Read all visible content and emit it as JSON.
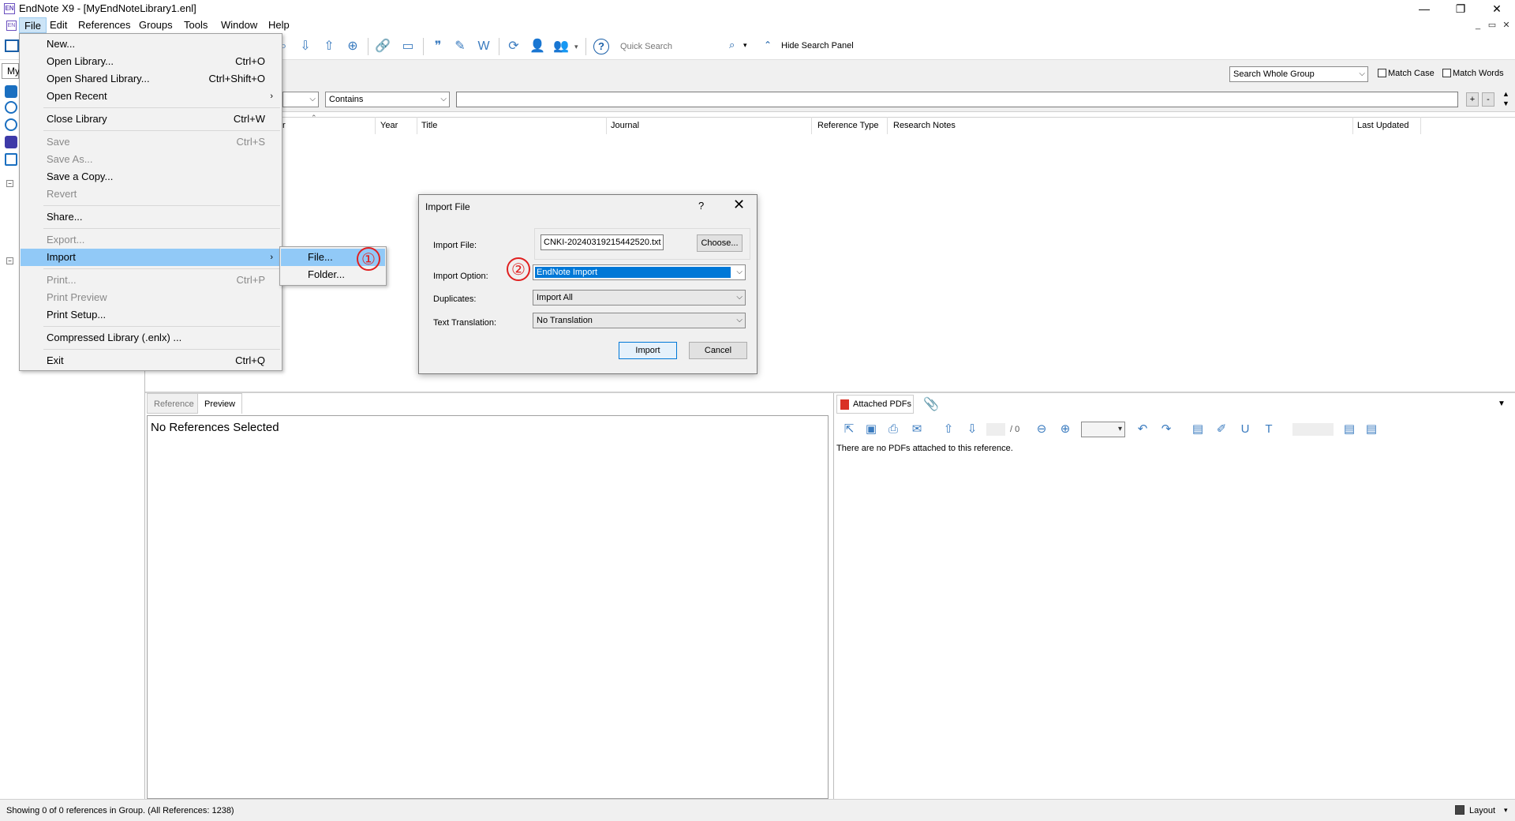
{
  "window": {
    "title": "EndNote X9 - [MyEndNoteLibrary1.enl]",
    "app_icon": "EN",
    "minimize": "—",
    "restore": "❐",
    "close": "✕"
  },
  "menubar": {
    "file": "File",
    "edit": "Edit",
    "references": "References",
    "groups": "Groups",
    "tools": "Tools",
    "window": "Window",
    "help": "Help"
  },
  "toolbar": {
    "quick_search_placeholder": "Quick Search",
    "hide_search_panel": "Hide Search Panel"
  },
  "search_panel": {
    "scope": "Search Whole Group",
    "match_case": "Match Case",
    "match_words": "Match Words",
    "condition": "Contains",
    "add": "+",
    "remove": "-"
  },
  "left_panel": {
    "tab_label": "My"
  },
  "columns": [
    "r",
    "Year",
    "Title",
    "Journal",
    "Reference Type",
    "Research Notes",
    "Last Updated"
  ],
  "file_menu": {
    "items": [
      {
        "label": "New...",
        "shortcut": "",
        "disabled": false
      },
      {
        "label": "Open Library...",
        "shortcut": "Ctrl+O",
        "disabled": false
      },
      {
        "label": "Open Shared Library...",
        "shortcut": "Ctrl+Shift+O",
        "disabled": false
      },
      {
        "label": "Open Recent",
        "shortcut": "",
        "disabled": false
      },
      {
        "label": "Close Library",
        "shortcut": "Ctrl+W",
        "disabled": false
      },
      {
        "label": "Save",
        "shortcut": "Ctrl+S",
        "disabled": true
      },
      {
        "label": "Save As...",
        "shortcut": "",
        "disabled": true
      },
      {
        "label": "Save a Copy...",
        "shortcut": "",
        "disabled": false
      },
      {
        "label": "Revert",
        "shortcut": "",
        "disabled": true
      },
      {
        "label": "Share...",
        "shortcut": "",
        "disabled": false
      },
      {
        "label": "Export...",
        "shortcut": "",
        "disabled": true
      },
      {
        "label": "Import",
        "shortcut": "",
        "disabled": false
      },
      {
        "label": "Print...",
        "shortcut": "Ctrl+P",
        "disabled": true
      },
      {
        "label": "Print Preview",
        "shortcut": "",
        "disabled": true
      },
      {
        "label": "Print Setup...",
        "shortcut": "",
        "disabled": false
      },
      {
        "label": "Compressed Library (.enlx) ...",
        "shortcut": "",
        "disabled": false
      },
      {
        "label": "Exit",
        "shortcut": "Ctrl+Q",
        "disabled": false
      }
    ],
    "submenu_arrow": "›"
  },
  "import_submenu": {
    "file": "File...",
    "folder": "Folder..."
  },
  "annotations": {
    "step1": "①",
    "step2": "②"
  },
  "import_dialog": {
    "title": "Import File",
    "help": "?",
    "close": "✕",
    "import_file_label": "Import File:",
    "import_file_value": "CNKI-20240319215442520.txt",
    "choose": "Choose...",
    "import_option_label": "Import Option:",
    "import_option_value": "EndNote Import",
    "duplicates_label": "Duplicates:",
    "duplicates_value": "Import All",
    "text_translation_label": "Text Translation:",
    "text_translation_value": "No Translation",
    "import_button": "Import",
    "cancel_button": "Cancel"
  },
  "bottom_tabs": {
    "reference": "Reference",
    "preview": "Preview"
  },
  "preview": {
    "message": "No References Selected"
  },
  "pdf_panel": {
    "tab": "Attached PDFs",
    "message": "There are no PDFs attached to this reference.",
    "page_count": "/ 0"
  },
  "status": {
    "text": "Showing 0 of 0 references in Group. (All References: 1238)",
    "layout": "Layout"
  },
  "colors": {
    "highlight": "#91c9f7",
    "accent": "#0078d7",
    "annotation": "#e02020",
    "icon_blue": "#3a7bbf"
  }
}
